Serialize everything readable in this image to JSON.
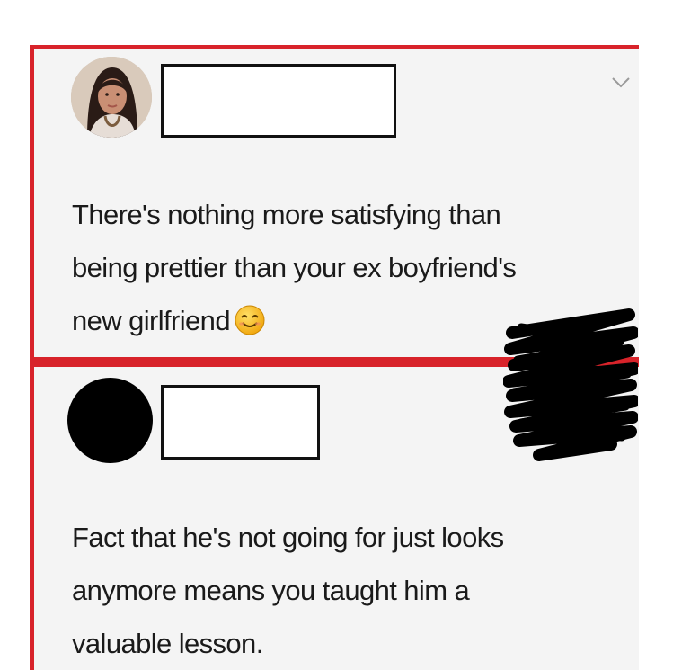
{
  "posts": [
    {
      "avatar_icon": "user-photo-avatar",
      "username": "",
      "menu_icon": "chevron-down-icon",
      "text_lines": [
        "There's nothing more satisfying than",
        "being prettier than your ex boyfriend's",
        "new girlfriend"
      ],
      "emoji_icon": "smiling-face-emoji-icon"
    },
    {
      "avatar_icon": "redacted-avatar",
      "username": "",
      "text_lines": [
        "Fact that he's not going for just looks",
        "anymore means you taught him a",
        "valuable lesson."
      ]
    }
  ],
  "colors": {
    "frame_red": "#d8232a",
    "post_background": "#f4f4f4",
    "text": "#1a1a1a",
    "redaction_black": "#000000"
  }
}
